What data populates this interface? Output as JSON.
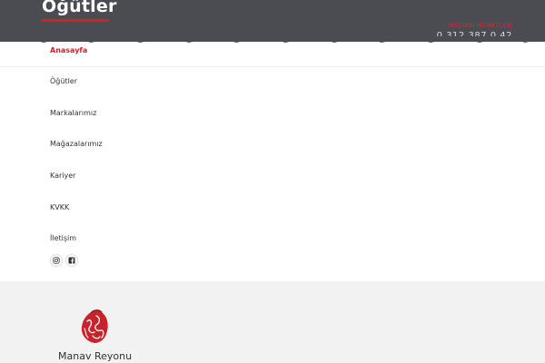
{
  "header": {
    "logo_text": "Öğütler",
    "contact_label": "MÜŞTERİ HİZMETLERİ",
    "phone": "0 312 387 0 42"
  },
  "nav": {
    "items": [
      {
        "label": "Anasayfa",
        "active": true
      },
      {
        "label": "Öğütler",
        "active": false
      },
      {
        "label": "Markalarımız",
        "active": false
      },
      {
        "label": "Mağazalarımız",
        "active": false
      },
      {
        "label": "Kariyer",
        "active": false
      },
      {
        "label": "KVKK",
        "active": false
      },
      {
        "label": "İletişim",
        "active": false
      }
    ]
  },
  "social": {
    "icons": [
      "instagram-icon",
      "facebook-icon"
    ]
  },
  "category": {
    "label": "Manav Reyonu",
    "icon": "lettuce-icon"
  },
  "colors": {
    "header_bg": "#4a4c52",
    "accent": "#d0202a",
    "footer_bg": "#f2f2f2"
  }
}
